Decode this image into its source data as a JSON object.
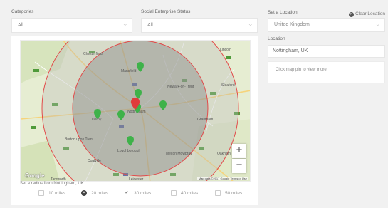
{
  "filters": {
    "categories": {
      "label": "Categories",
      "value": "All"
    },
    "status": {
      "label": "Social Enterprise Status",
      "value": "All"
    }
  },
  "location": {
    "set_label": "Set a Location",
    "clear_label": "Clear Location",
    "country": "United Kingdom",
    "location_label": "Location",
    "location_value": "Nottingham, UK",
    "info_text": "Click map pin to view more"
  },
  "map": {
    "place_names": [
      "Chesterfield",
      "Mansfield",
      "Newark-on-Trent",
      "Nottingham",
      "Derby",
      "Grantham",
      "Loughborough",
      "Melton Mowbray",
      "Burton upon Trent",
      "Leicester",
      "Oakham",
      "Coalville",
      "Tamworth",
      "Sleaford",
      "Lincoln"
    ],
    "pin_count": 8,
    "google_mark": "Google",
    "attribution": "Map data ©2017 Google   Terms of Use",
    "zoom_in": "+",
    "zoom_out": "−",
    "colors": {
      "radius_fill": "#8a8a8a",
      "radius_stroke": "#e24a4a",
      "pin": "#3fb24a",
      "center_pin": "#e03b3b"
    }
  },
  "radius": {
    "label": "Set a radius from Nottingham, UK",
    "options": [
      {
        "label": "10 miles",
        "state": "unchecked"
      },
      {
        "label": "20 miles",
        "state": "dark"
      },
      {
        "label": "30 miles",
        "state": "checked"
      },
      {
        "label": "40 miles",
        "state": "unchecked"
      },
      {
        "label": "50 miles",
        "state": "unchecked"
      }
    ]
  },
  "icons": {
    "chevron": "chevron-down-icon",
    "clear": "close-circle-icon",
    "check": "check-icon"
  }
}
